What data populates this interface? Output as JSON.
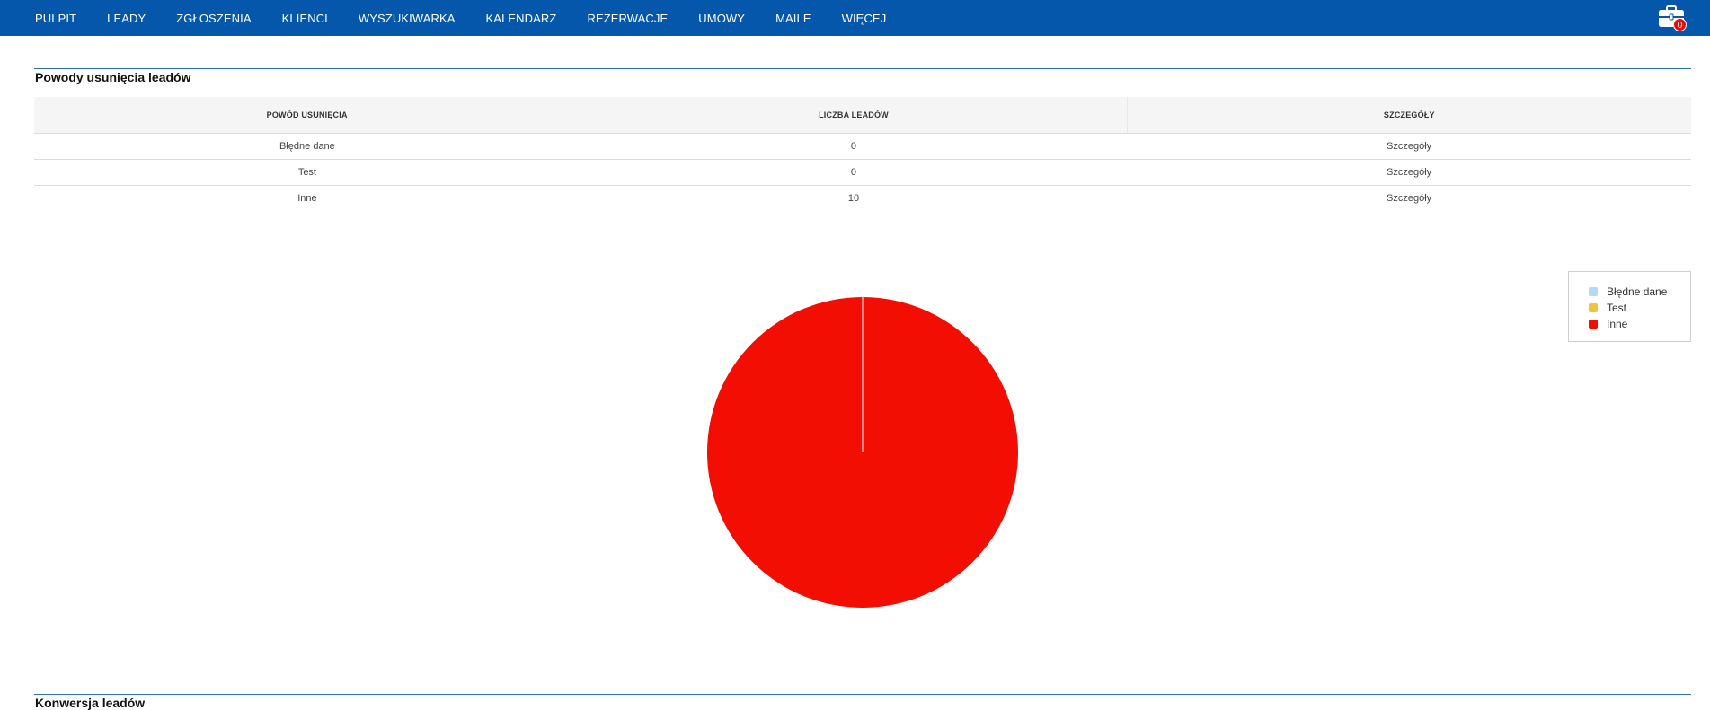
{
  "nav": {
    "items": [
      "PULPIT",
      "LEADY",
      "ZGŁOSZENIA",
      "KLIENCI",
      "WYSZUKIWARKA",
      "KALENDARZ",
      "REZERWACJE",
      "UMOWY",
      "MAILE",
      "WIĘCEJ"
    ],
    "badge_count": "0"
  },
  "section1": {
    "title": "Powody usunięcia leadów"
  },
  "table": {
    "headers": [
      "POWÓD USUNIĘCIA",
      "LICZBA LEADÓW",
      "SZCZEGÓŁY"
    ],
    "rows": [
      {
        "reason": "Błędne dane",
        "count": "0",
        "details": "Szczegóły"
      },
      {
        "reason": "Test",
        "count": "0",
        "details": "Szczegóły"
      },
      {
        "reason": "Inne",
        "count": "10",
        "details": "Szczegóły"
      }
    ]
  },
  "chart_data": {
    "type": "pie",
    "categories": [
      "Błędne dane",
      "Test",
      "Inne"
    ],
    "values": [
      0,
      0,
      10
    ],
    "colors": [
      "#b3dbf5",
      "#f5c33b",
      "#f20e03"
    ],
    "legend_position": "top-right"
  },
  "section2": {
    "title": "Konwersja leadów"
  }
}
